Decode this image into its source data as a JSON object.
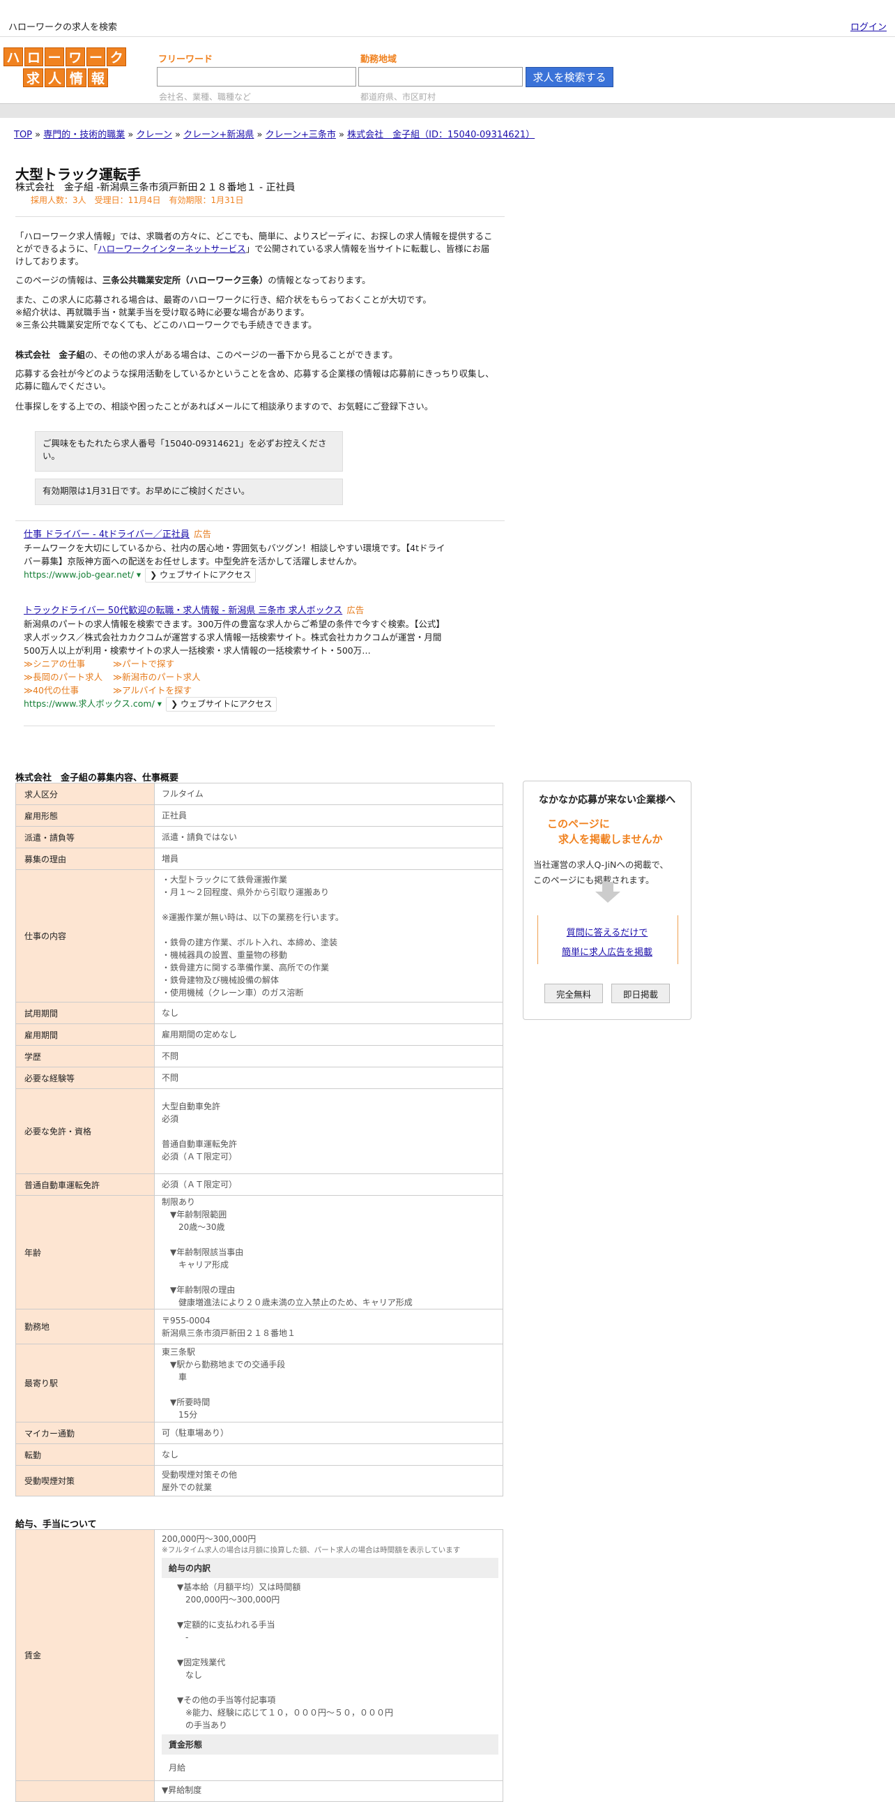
{
  "header": {
    "site_title": "ハローワークの求人を検索",
    "login_label": "ログイン",
    "logo_row1": [
      "ハ",
      "ロ",
      "ー",
      "ワ",
      "ー",
      "ク"
    ],
    "logo_row2": [
      "求",
      "人",
      "情",
      "報"
    ]
  },
  "search": {
    "keyword_label": "フリーワード",
    "keyword_placeholder": "会社名、業種、職種など",
    "area_label": "勤務地域",
    "area_placeholder": "都道府県、市区町村",
    "search_button": "求人を検索する"
  },
  "breadcrumb": {
    "items": [
      "TOP",
      "専門的・技術的職業",
      "クレーン",
      "クレーン+新潟県",
      "クレーン+三条市",
      "株式会社　金子組（ID：15040-09314621）"
    ],
    "separator": "»"
  },
  "job": {
    "title": "大型トラック運転手",
    "company_line": "株式会社　金子組 -新潟県三条市須戸新田２１８番地１ - 正社員",
    "meta": "採用人数：3人　受理日：11月4日　有効期限：1月31日"
  },
  "intro": {
    "p1_before": "「ハローワーク求人情報」では、求職者の方々に、どこでも、簡単に、よりスピーディに、お探しの求人情報を提供することができるように、「",
    "p1_link": "ハローワークインターネットサービス",
    "p1_after": "」で公開されている求人情報を当サイトに転載し、皆様にお届けしております。",
    "p2_before": "このページの情報は、",
    "p2_bold": "三条公共職業安定所（ハローワーク三条）",
    "p2_after": "の情報となっております。",
    "p3": "また、この求人に応募される場合は、最寄のハローワークに行き、紹介状をもらっておくことが大切です。\n※紹介状は、再就職手当・就業手当を受け取る時に必要な場合があります。\n※三条公共職業安定所でなくても、どこのハローワークでも手続きできます。",
    "p4_bold": "株式会社　金子組",
    "p4_after": "の、その他の求人がある場合は、このページの一番下から見ることができます。",
    "p5": "応募する会社が今どのような採用活動をしているかということを含め、応募する企業様の情報は応募前にきっちり収集し、応募に臨んでください。",
    "p6": "仕事探しをする上での、相談や困ったことがあればメールにて相談承りますので、お気軽にご登録下さい。",
    "note1": "ご興味をもたれたら求人番号「15040-09314621」を必ずお控えください。",
    "note2": "有効期限は1月31日です。お早めにご検討ください。"
  },
  "ads": [
    {
      "title": "仕事 ドライバー - 4tドライバー／正社員",
      "tag": "広告",
      "desc": "チームワークを大切にしているから、社内の居心地・雰囲気もバツグン！相談しやすい環境です。【4tドライバー募集】京阪神方面への配送をお任せします。中型免許を活かして活躍しませんか。",
      "url": "https://www.job-gear.net/",
      "visit": "ウェブサイトにアクセス"
    },
    {
      "title": "トラックドライバー 50代歓迎の転職・求人情報 - 新潟県 三条市 求人ボックス",
      "tag": "広告",
      "desc": "新潟県のパートの求人情報を検索できます。300万件の豊富な求人からご希望の条件で今すぐ検索。【公式】求人ボックス／株式会社カカクコムが運営する求人情報一括検索サイト。株式会社カカクコムが運営・月間500万人以上が利用・検索サイトの求人一括検索・求人情報の一括検索サイト・500万…",
      "sublinks": [
        "≫シニアの仕事",
        "≫パートで探す",
        "≫長岡のパート求人",
        "≫新潟市のパート求人",
        "≫40代の仕事",
        "≫アルバイトを探す"
      ],
      "url": "https://www.求人ボックス.com/",
      "visit": "ウェブサイトにアクセス"
    }
  ],
  "details": {
    "section_title": "株式会社　金子組の募集内容、仕事概要",
    "rows": [
      {
        "k": "求人区分",
        "v": "フルタイム"
      },
      {
        "k": "雇用形態",
        "v": "正社員"
      },
      {
        "k": "派遣・請負等",
        "v": "派遣・請負ではない"
      },
      {
        "k": "募集の理由",
        "v": "増員"
      },
      {
        "k": "仕事の内容",
        "v": "・大型トラックにて鉄骨運搬作業\n・月１～２回程度、県外から引取り運搬あり\n\n※運搬作業が無い時は、以下の業務を行います。\n\n・鉄骨の建方作業、ボルト入れ、本締め、塗装\n・機械器具の設置、重量物の移動\n・鉄骨建方に関する準備作業、高所での作業\n・鉄骨建物及び機械設備の解体\n・使用機械（クレーン車）のガス溶断"
      },
      {
        "k": "試用期間",
        "v": "なし"
      },
      {
        "k": "雇用期間",
        "v": "雇用期間の定めなし"
      },
      {
        "k": "学歴",
        "v": "不問"
      },
      {
        "k": "必要な経験等",
        "v": "不問"
      },
      {
        "k": "必要な免許・資格",
        "v": "大型自動車免許\n必須\n\n普通自動車運転免許\n必須（ＡＴ限定可）"
      },
      {
        "k": "普通自動車運転免許",
        "v": "必須（ＡＴ限定可）"
      },
      {
        "k": "年齢",
        "v": "制限あり\n　▼年齢制限範囲\n　　20歳〜30歳\n\n　▼年齢制限該当事由\n　　キャリア形成\n\n　▼年齢制限の理由\n　　健康増進法により２０歳未満の立入禁止のため、キャリア形成"
      },
      {
        "k": "勤務地",
        "v": "〒955-0004\n新潟県三条市須戸新田２１８番地１"
      },
      {
        "k": "最寄り駅",
        "v": "東三条駅\n　▼駅から勤務地までの交通手段\n　　車\n\n　▼所要時間\n　　15分"
      },
      {
        "k": "マイカー通勤",
        "v": "可（駐車場あり）"
      },
      {
        "k": "転勤",
        "v": "なし"
      },
      {
        "k": "受動喫煙対策",
        "v": "受動喫煙対策その他\n屋外での就業"
      }
    ]
  },
  "wages": {
    "section_title": "給与、手当について",
    "key": "賃金",
    "amount": "200,000円〜300,000円",
    "amount_note": "※フルタイム求人の場合は月額に換算した額、パート求人の場合は時間額を表示しています",
    "breakdown_title": "給与の内訳",
    "breakdown": "　▼基本給（月額平均）又は時間額\n　　200,000円〜300,000円\n\n　▼定額的に支払われる手当\n　　-\n\n　▼固定残業代\n　　なし\n\n　▼その他の手当等付記事項\n　　※能力、経験に応じて１０，０００円〜５０，０００円\n　　の手当あり",
    "form_title": "賃金形態",
    "form_value": "月給",
    "next_row_text": "▼昇給制度"
  },
  "sidebar": {
    "heading": "なかなか応募が来ない企業様へ",
    "orange1": "このページに",
    "orange2": "求人を掲載しませんか",
    "desc1": "当社運営の求人Q-JiNへの掲載で、",
    "desc2": "このページにも掲載されます。",
    "link1": "質問に答えるだけで",
    "link2": "簡単に求人広告を掲載",
    "btn1": "完全無料",
    "btn2": "即日掲載"
  }
}
